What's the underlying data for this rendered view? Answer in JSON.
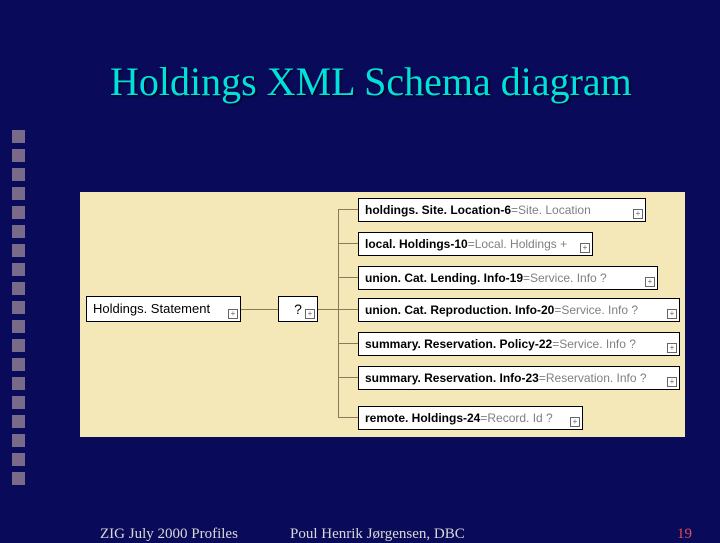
{
  "title": "Holdings XML Schema diagram",
  "diagram": {
    "root": "Holdings. Statement",
    "sequence": "?",
    "children": [
      {
        "bold": "holdings. Site. Location-6",
        "type": "=Site. Location"
      },
      {
        "bold": "local. Holdings-10",
        "type": "=Local. Holdings +"
      },
      {
        "bold": "union. Cat. Lending. Info-19",
        "type": "=Service. Info ?"
      },
      {
        "bold": "union. Cat. Reproduction. Info-20",
        "type": "=Service. Info ?"
      },
      {
        "bold": "summary. Reservation. Policy-22",
        "type": "=Service. Info ?"
      },
      {
        "bold": "summary. Reservation. Info-23",
        "type": "=Reservation. Info ?"
      },
      {
        "bold": "remote. Holdings-24",
        "type": "=Record. Id ?"
      }
    ]
  },
  "footer": {
    "left": "ZIG July 2000 Profiles",
    "center": "Poul Henrik Jørgensen, DBC",
    "page": "19"
  }
}
